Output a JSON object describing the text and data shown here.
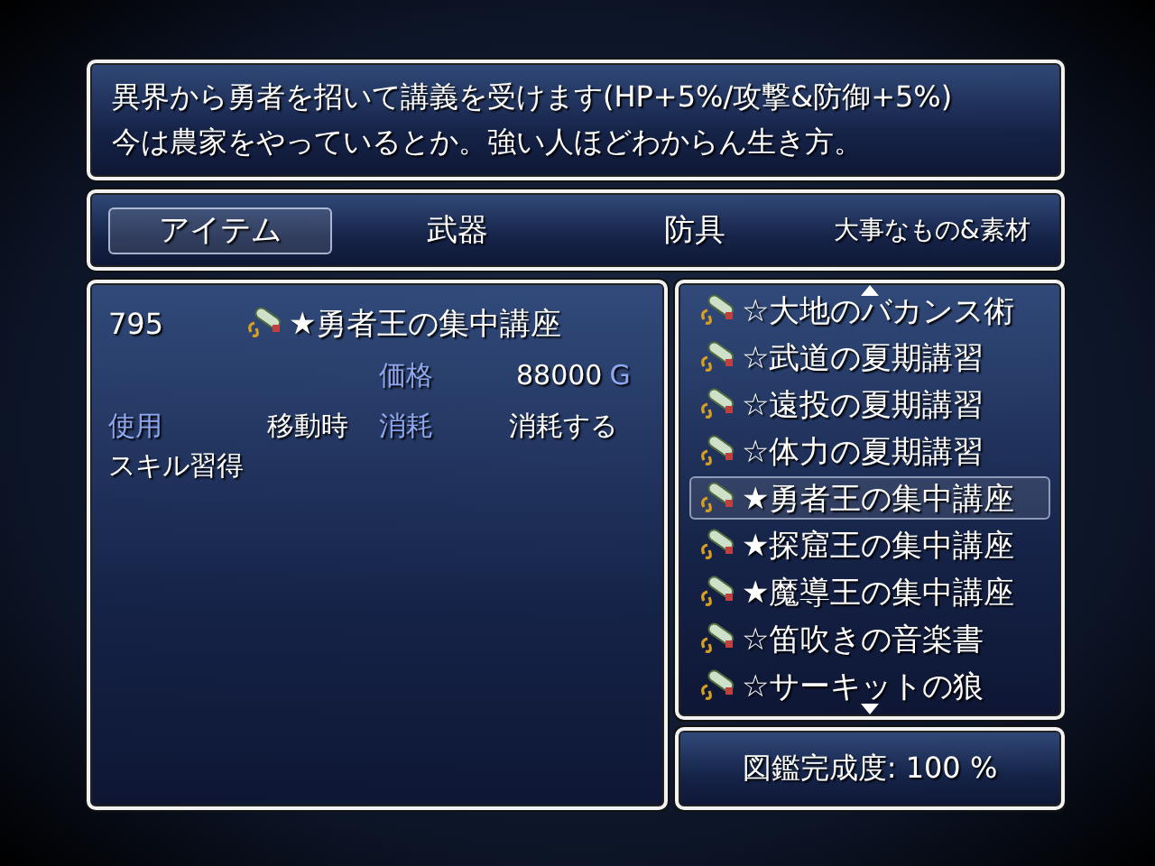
{
  "help": {
    "lines": [
      "異界から勇者を招いて講義を受けます(HP+5%/攻撃&防御+5%)",
      "今は農家をやっているとか。強い人ほどわからん生き方。"
    ]
  },
  "tabs": [
    {
      "label": "アイテム",
      "selected": true
    },
    {
      "label": "武器",
      "selected": false
    },
    {
      "label": "防具",
      "selected": false
    },
    {
      "label": "大事なもの&素材",
      "selected": false
    }
  ],
  "detail": {
    "number": "795",
    "name": "★勇者王の集中講座",
    "price": {
      "label": "価格",
      "value": "88000",
      "unit": "G"
    },
    "fields": [
      {
        "label": "使用",
        "value": "移動時"
      },
      {
        "label": "消耗",
        "value": "消耗する"
      }
    ],
    "effect": "スキル習得"
  },
  "list": {
    "items": [
      {
        "name": "☆大地のバカンス術",
        "selected": false
      },
      {
        "name": "☆武道の夏期講習",
        "selected": false
      },
      {
        "name": "☆遠投の夏期講習",
        "selected": false
      },
      {
        "name": "☆体力の夏期講習",
        "selected": false
      },
      {
        "name": "★勇者王の集中講座",
        "selected": true
      },
      {
        "name": "★探窟王の集中講座",
        "selected": false
      },
      {
        "name": "★魔導王の集中講座",
        "selected": false
      },
      {
        "name": "☆笛吹きの音楽書",
        "selected": false
      },
      {
        "name": "☆サーキットの狼",
        "selected": false
      }
    ]
  },
  "completion": {
    "text": "図鑑完成度: 100 %"
  }
}
